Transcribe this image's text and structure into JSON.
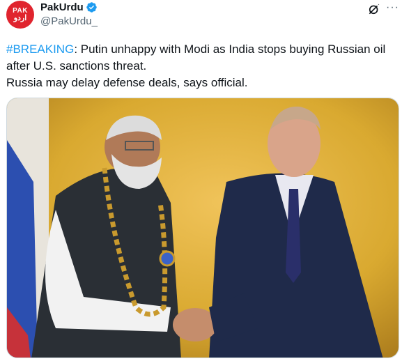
{
  "tweet": {
    "avatar_text_top": "PAK",
    "avatar_text_bottom": "اردو",
    "display_name": "PakUrdu",
    "handle": "@PakUrdu_",
    "hashtag": "#BREAKING",
    "text_line1_rest": ": Putin unhappy with Modi as India stops buying Russian oil after U.S. sanctions threat.",
    "text_line2": "Russia may delay defense deals, says official.",
    "more_label": "···"
  },
  "colors": {
    "avatar": "#e0242e",
    "hashtag": "#1d9bf0",
    "verified": "#1d9bf0",
    "background_wall": "#d9a930"
  },
  "icons": {
    "verified": "verified-badge-icon",
    "grok": "grok-icon",
    "more": "more-dots-icon"
  }
}
